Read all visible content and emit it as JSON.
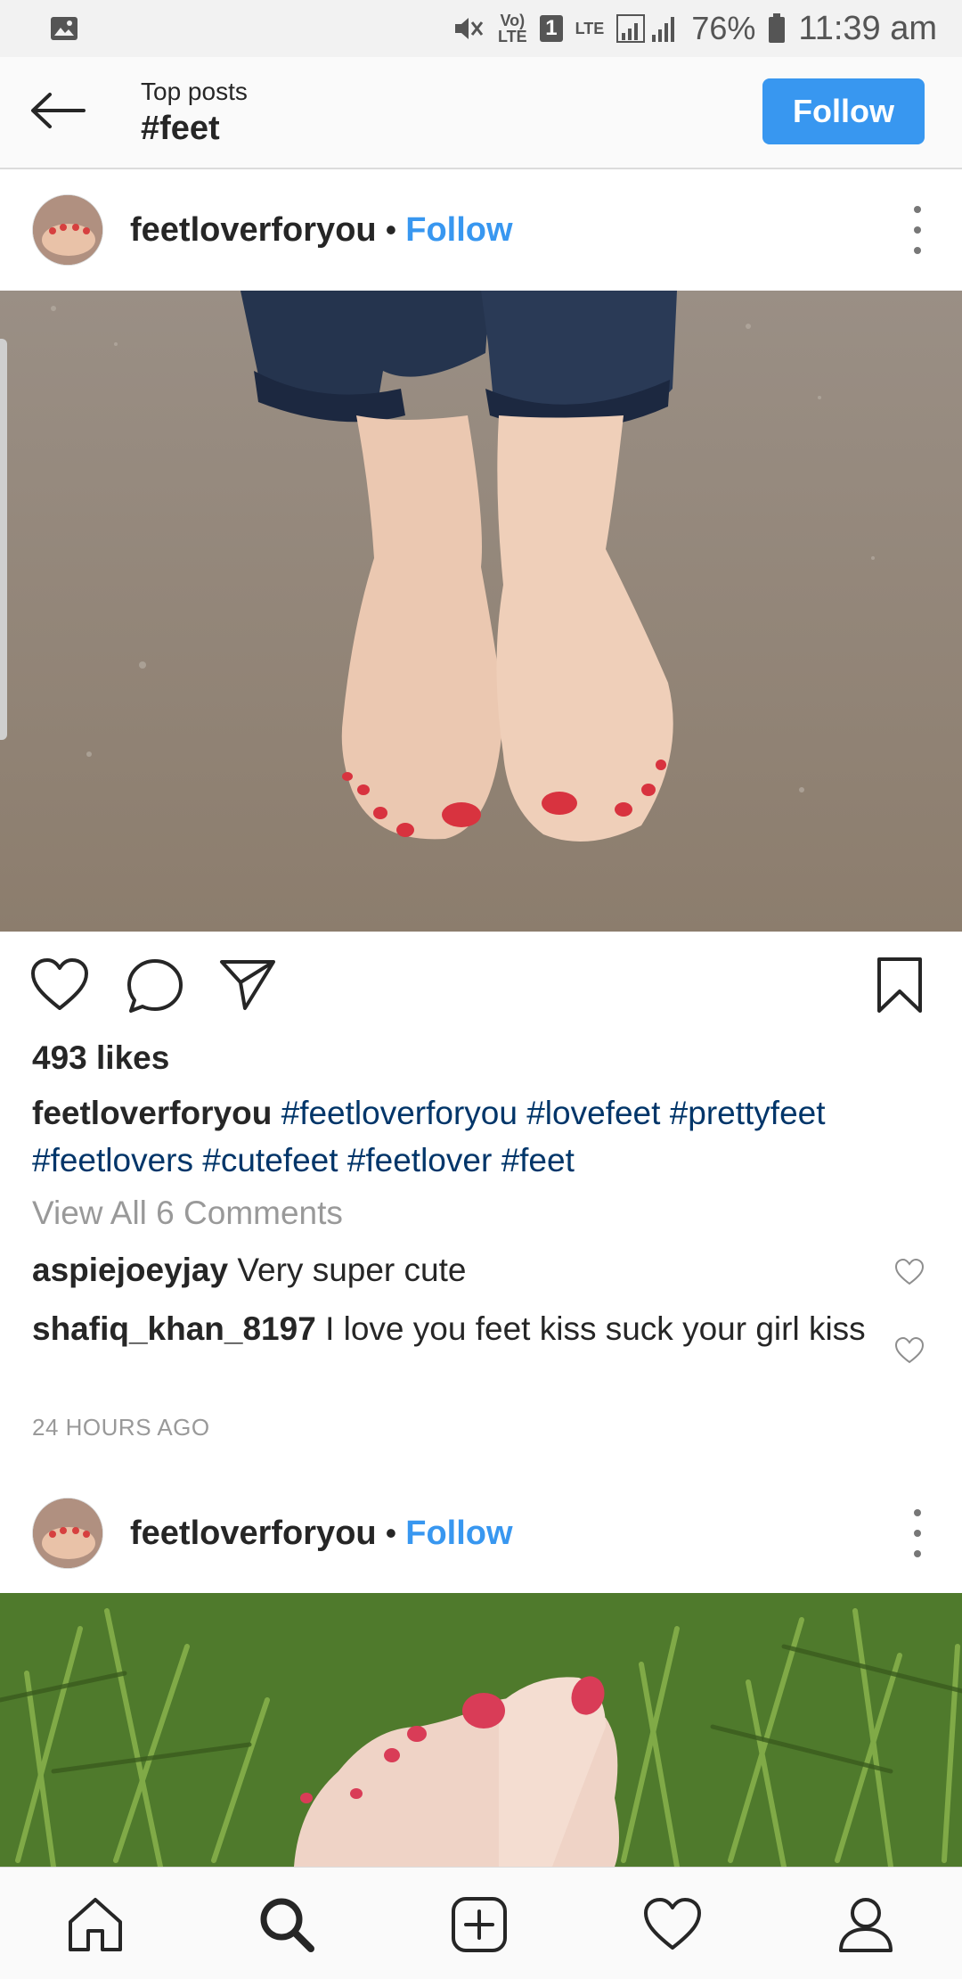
{
  "status_bar": {
    "volte": "Vo) LTE",
    "sim": "1",
    "lte": "LTE",
    "battery": "76%",
    "time": "11:39 am"
  },
  "header": {
    "subtitle": "Top posts",
    "title": "#feet",
    "follow_label": "Follow"
  },
  "posts": [
    {
      "username": "feetloverforyou",
      "separator": "•",
      "follow_label": "Follow",
      "likes": "493 likes",
      "caption_user": "feetloverforyou",
      "hashtags": [
        "#feetloverforyou",
        "#lovefeet",
        "#prettyfeet",
        "#feetlovers",
        "#cutefeet",
        "#feetlover",
        "#feet"
      ],
      "view_comments": "View All 6 Comments",
      "comments": [
        {
          "user": "aspiejoeyjay",
          "text": "Very super cute"
        },
        {
          "user": "shafiq_khan_8197",
          "text": "I love you feet kiss suck your girl kiss"
        }
      ],
      "time_ago": "24 HOURS AGO"
    },
    {
      "username": "feetloverforyou",
      "separator": "•",
      "follow_label": "Follow"
    }
  ],
  "icons": {
    "gallery": "image-icon",
    "back": "arrow-left-icon",
    "more": "more-vertical-icon",
    "like": "heart-icon",
    "comment": "comment-bubble-icon",
    "share": "paper-plane-icon",
    "save": "bookmark-icon",
    "nav_home": "home-icon",
    "nav_search": "search-icon",
    "nav_add": "add-post-icon",
    "nav_activity": "heart-icon",
    "nav_profile": "profile-icon"
  },
  "colors": {
    "accent": "#3897f0",
    "hashtag": "#003569",
    "muted": "#999999"
  }
}
